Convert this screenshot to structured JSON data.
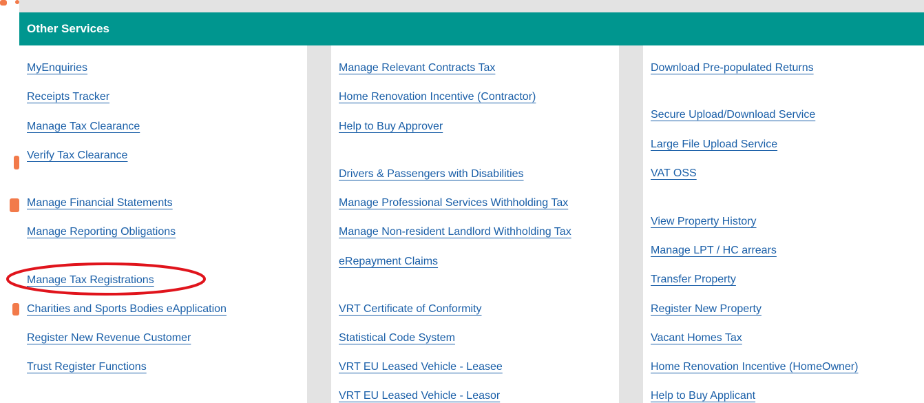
{
  "panel": {
    "title": "Other Services"
  },
  "columns": [
    {
      "links": [
        "MyEnquiries",
        "Receipts Tracker",
        "Manage Tax Clearance",
        "Verify Tax Clearance",
        "Manage Financial Statements",
        "Manage Reporting Obligations",
        "Manage Tax Registrations",
        "Charities and Sports Bodies eApplication",
        "Register New Revenue Customer",
        "Trust Register Functions"
      ]
    },
    {
      "links": [
        "Manage Relevant Contracts Tax",
        "Home Renovation Incentive (Contractor)",
        "Help to Buy Approver",
        "Drivers & Passengers with Disabilities",
        "Manage Professional Services Withholding Tax",
        "Manage Non-resident Landlord Withholding Tax",
        "eRepayment Claims",
        "VRT Certificate of Conformity",
        "Statistical Code System",
        "VRT EU Leased Vehicle - Leasee",
        "VRT EU Leased Vehicle - Leasor"
      ]
    },
    {
      "links": [
        "Download Pre-populated Returns",
        "Secure Upload/Download Service",
        "Large File Upload Service",
        "VAT OSS",
        "View Property History",
        "Manage LPT / HC arrears",
        "Transfer Property",
        "Register New Property",
        "Vacant Homes Tax",
        "Home Renovation Incentive (HomeOwner)",
        "Help to Buy Applicant"
      ]
    }
  ],
  "annotation": {
    "highlighted_item": "Manage Tax Registrations",
    "color": "#e0141c"
  },
  "colors": {
    "header_bg": "#00968f",
    "link": "#1a5fa8",
    "gutter": "#e3e3e3"
  }
}
